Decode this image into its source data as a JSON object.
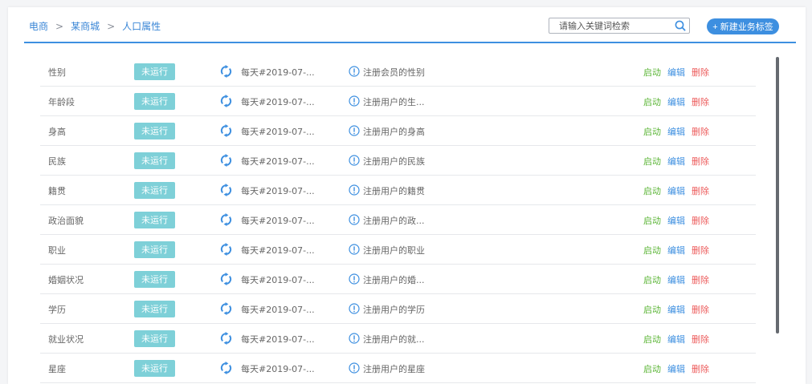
{
  "breadcrumb": {
    "items": [
      "电商",
      "某商城",
      "人口属性"
    ],
    "separator": ">"
  },
  "search": {
    "placeholder": "请输入关键词检索",
    "value": ""
  },
  "new_button_label": "+ 新建业务标签",
  "colors": {
    "accent": "#3d8fe0",
    "badge": "#7ed0d8",
    "start": "#5bb536",
    "delete": "#ec5a5a"
  },
  "actions": {
    "start": "启动",
    "edit": "编辑",
    "delete": "删除"
  },
  "rows": [
    {
      "name": "性别",
      "status": "未运行",
      "schedule": "每天#2019-07-...",
      "desc": "注册会员的性别"
    },
    {
      "name": "年龄段",
      "status": "未运行",
      "schedule": "每天#2019-07-...",
      "desc": "注册用户的生..."
    },
    {
      "name": "身高",
      "status": "未运行",
      "schedule": "每天#2019-07-...",
      "desc": "注册用户的身高"
    },
    {
      "name": "民族",
      "status": "未运行",
      "schedule": "每天#2019-07-...",
      "desc": "注册用户的民族"
    },
    {
      "name": "籍贯",
      "status": "未运行",
      "schedule": "每天#2019-07-...",
      "desc": "注册用户的籍贯"
    },
    {
      "name": "政治面貌",
      "status": "未运行",
      "schedule": "每天#2019-07-...",
      "desc": "注册用户的政..."
    },
    {
      "name": "职业",
      "status": "未运行",
      "schedule": "每天#2019-07-...",
      "desc": "注册用户的职业"
    },
    {
      "name": "婚姻状况",
      "status": "未运行",
      "schedule": "每天#2019-07-...",
      "desc": "注册用户的婚..."
    },
    {
      "name": "学历",
      "status": "未运行",
      "schedule": "每天#2019-07-...",
      "desc": "注册用户的学历"
    },
    {
      "name": "就业状况",
      "status": "未运行",
      "schedule": "每天#2019-07-...",
      "desc": "注册用户的就..."
    },
    {
      "name": "星座",
      "status": "未运行",
      "schedule": "每天#2019-07-...",
      "desc": "注册用户的星座"
    }
  ]
}
